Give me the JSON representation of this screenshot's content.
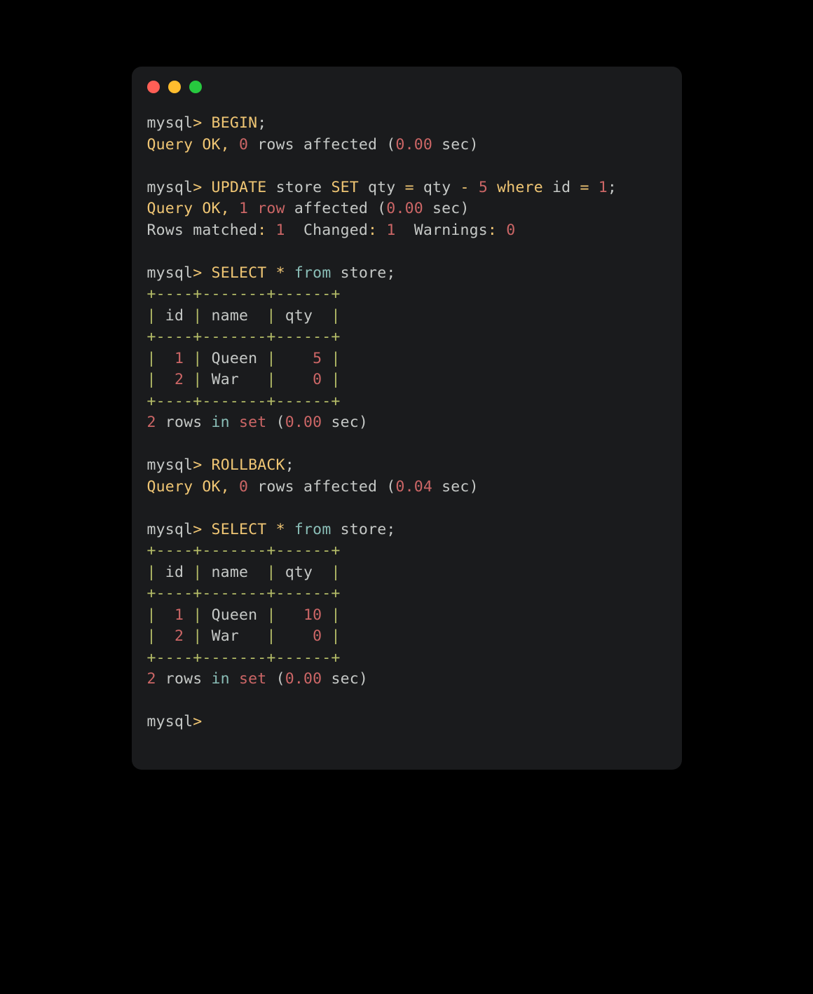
{
  "colors": {
    "traffic_red": "#ff5f56",
    "traffic_yellow": "#ffbd2e",
    "traffic_green": "#27c93f",
    "bg": "#1a1b1d",
    "text": "#c5c8c6",
    "yellow": "#f0c674",
    "red": "#cc6666",
    "cyan": "#8abeb7",
    "green": "#b5bd68"
  },
  "tokens": [
    {
      "t": "mysql",
      "c": "default"
    },
    {
      "t": ">",
      "c": "yellow"
    },
    {
      "t": " ",
      "c": "default"
    },
    {
      "t": "BEGIN",
      "c": "yellow"
    },
    {
      "t": ";",
      "c": "default"
    },
    {
      "t": "\n",
      "c": "default"
    },
    {
      "t": "Query OK,",
      "c": "yellow"
    },
    {
      "t": " ",
      "c": "default"
    },
    {
      "t": "0",
      "c": "red"
    },
    {
      "t": " rows affected (",
      "c": "default"
    },
    {
      "t": "0.00",
      "c": "red"
    },
    {
      "t": " sec)",
      "c": "default"
    },
    {
      "t": "\n",
      "c": "default"
    },
    {
      "t": "\n",
      "c": "default"
    },
    {
      "t": "mysql",
      "c": "default"
    },
    {
      "t": ">",
      "c": "yellow"
    },
    {
      "t": " ",
      "c": "default"
    },
    {
      "t": "UPDATE",
      "c": "yellow"
    },
    {
      "t": " store ",
      "c": "default"
    },
    {
      "t": "SET",
      "c": "yellow"
    },
    {
      "t": " qty ",
      "c": "default"
    },
    {
      "t": "=",
      "c": "yellow"
    },
    {
      "t": " qty ",
      "c": "default"
    },
    {
      "t": "-",
      "c": "yellow"
    },
    {
      "t": " ",
      "c": "default"
    },
    {
      "t": "5",
      "c": "red"
    },
    {
      "t": " ",
      "c": "default"
    },
    {
      "t": "where",
      "c": "yellow"
    },
    {
      "t": " id ",
      "c": "default"
    },
    {
      "t": "=",
      "c": "yellow"
    },
    {
      "t": " ",
      "c": "default"
    },
    {
      "t": "1",
      "c": "red"
    },
    {
      "t": ";",
      "c": "default"
    },
    {
      "t": "\n",
      "c": "default"
    },
    {
      "t": "Query OK,",
      "c": "yellow"
    },
    {
      "t": " ",
      "c": "default"
    },
    {
      "t": "1",
      "c": "red"
    },
    {
      "t": " ",
      "c": "default"
    },
    {
      "t": "row",
      "c": "red"
    },
    {
      "t": " affected (",
      "c": "default"
    },
    {
      "t": "0.00",
      "c": "red"
    },
    {
      "t": " sec)",
      "c": "default"
    },
    {
      "t": "\n",
      "c": "default"
    },
    {
      "t": "Rows matched",
      "c": "default"
    },
    {
      "t": ":",
      "c": "yellow"
    },
    {
      "t": " ",
      "c": "default"
    },
    {
      "t": "1",
      "c": "red"
    },
    {
      "t": "  Changed",
      "c": "default"
    },
    {
      "t": ":",
      "c": "yellow"
    },
    {
      "t": " ",
      "c": "default"
    },
    {
      "t": "1",
      "c": "red"
    },
    {
      "t": "  Warnings",
      "c": "default"
    },
    {
      "t": ":",
      "c": "yellow"
    },
    {
      "t": " ",
      "c": "default"
    },
    {
      "t": "0",
      "c": "red"
    },
    {
      "t": "\n",
      "c": "default"
    },
    {
      "t": "\n",
      "c": "default"
    },
    {
      "t": "mysql",
      "c": "default"
    },
    {
      "t": ">",
      "c": "yellow"
    },
    {
      "t": " ",
      "c": "default"
    },
    {
      "t": "SELECT",
      "c": "yellow"
    },
    {
      "t": " ",
      "c": "default"
    },
    {
      "t": "*",
      "c": "yellow"
    },
    {
      "t": " ",
      "c": "default"
    },
    {
      "t": "from",
      "c": "cyan"
    },
    {
      "t": " store;",
      "c": "default"
    },
    {
      "t": "\n",
      "c": "default"
    },
    {
      "t": "+----+-------+------+",
      "c": "green"
    },
    {
      "t": "\n",
      "c": "default"
    },
    {
      "t": "|",
      "c": "green"
    },
    {
      "t": " id ",
      "c": "default"
    },
    {
      "t": "|",
      "c": "green"
    },
    {
      "t": " name  ",
      "c": "default"
    },
    {
      "t": "|",
      "c": "green"
    },
    {
      "t": " qty  ",
      "c": "default"
    },
    {
      "t": "|",
      "c": "green"
    },
    {
      "t": "\n",
      "c": "default"
    },
    {
      "t": "+----+-------+------+",
      "c": "green"
    },
    {
      "t": "\n",
      "c": "default"
    },
    {
      "t": "|",
      "c": "green"
    },
    {
      "t": "  ",
      "c": "default"
    },
    {
      "t": "1",
      "c": "red"
    },
    {
      "t": " ",
      "c": "default"
    },
    {
      "t": "|",
      "c": "green"
    },
    {
      "t": " Queen ",
      "c": "default"
    },
    {
      "t": "|",
      "c": "green"
    },
    {
      "t": "    ",
      "c": "default"
    },
    {
      "t": "5",
      "c": "red"
    },
    {
      "t": " ",
      "c": "default"
    },
    {
      "t": "|",
      "c": "green"
    },
    {
      "t": "\n",
      "c": "default"
    },
    {
      "t": "|",
      "c": "green"
    },
    {
      "t": "  ",
      "c": "default"
    },
    {
      "t": "2",
      "c": "red"
    },
    {
      "t": " ",
      "c": "default"
    },
    {
      "t": "|",
      "c": "green"
    },
    {
      "t": " War   ",
      "c": "default"
    },
    {
      "t": "|",
      "c": "green"
    },
    {
      "t": "    ",
      "c": "default"
    },
    {
      "t": "0",
      "c": "red"
    },
    {
      "t": " ",
      "c": "default"
    },
    {
      "t": "|",
      "c": "green"
    },
    {
      "t": "\n",
      "c": "default"
    },
    {
      "t": "+----+-------+------+",
      "c": "green"
    },
    {
      "t": "\n",
      "c": "default"
    },
    {
      "t": "2",
      "c": "red"
    },
    {
      "t": " rows ",
      "c": "default"
    },
    {
      "t": "in",
      "c": "cyan"
    },
    {
      "t": " ",
      "c": "default"
    },
    {
      "t": "set",
      "c": "red"
    },
    {
      "t": " (",
      "c": "default"
    },
    {
      "t": "0.00",
      "c": "red"
    },
    {
      "t": " sec)",
      "c": "default"
    },
    {
      "t": "\n",
      "c": "default"
    },
    {
      "t": "\n",
      "c": "default"
    },
    {
      "t": "mysql",
      "c": "default"
    },
    {
      "t": ">",
      "c": "yellow"
    },
    {
      "t": " ",
      "c": "default"
    },
    {
      "t": "ROLLBACK",
      "c": "yellow"
    },
    {
      "t": ";",
      "c": "default"
    },
    {
      "t": "\n",
      "c": "default"
    },
    {
      "t": "Query OK,",
      "c": "yellow"
    },
    {
      "t": " ",
      "c": "default"
    },
    {
      "t": "0",
      "c": "red"
    },
    {
      "t": " rows affected (",
      "c": "default"
    },
    {
      "t": "0.04",
      "c": "red"
    },
    {
      "t": " sec)",
      "c": "default"
    },
    {
      "t": "\n",
      "c": "default"
    },
    {
      "t": "\n",
      "c": "default"
    },
    {
      "t": "mysql",
      "c": "default"
    },
    {
      "t": ">",
      "c": "yellow"
    },
    {
      "t": " ",
      "c": "default"
    },
    {
      "t": "SELECT",
      "c": "yellow"
    },
    {
      "t": " ",
      "c": "default"
    },
    {
      "t": "*",
      "c": "yellow"
    },
    {
      "t": " ",
      "c": "default"
    },
    {
      "t": "from",
      "c": "cyan"
    },
    {
      "t": " store;",
      "c": "default"
    },
    {
      "t": "\n",
      "c": "default"
    },
    {
      "t": "+----+-------+------+",
      "c": "green"
    },
    {
      "t": "\n",
      "c": "default"
    },
    {
      "t": "|",
      "c": "green"
    },
    {
      "t": " id ",
      "c": "default"
    },
    {
      "t": "|",
      "c": "green"
    },
    {
      "t": " name  ",
      "c": "default"
    },
    {
      "t": "|",
      "c": "green"
    },
    {
      "t": " qty  ",
      "c": "default"
    },
    {
      "t": "|",
      "c": "green"
    },
    {
      "t": "\n",
      "c": "default"
    },
    {
      "t": "+----+-------+------+",
      "c": "green"
    },
    {
      "t": "\n",
      "c": "default"
    },
    {
      "t": "|",
      "c": "green"
    },
    {
      "t": "  ",
      "c": "default"
    },
    {
      "t": "1",
      "c": "red"
    },
    {
      "t": " ",
      "c": "default"
    },
    {
      "t": "|",
      "c": "green"
    },
    {
      "t": " Queen ",
      "c": "default"
    },
    {
      "t": "|",
      "c": "green"
    },
    {
      "t": "   ",
      "c": "default"
    },
    {
      "t": "10",
      "c": "red"
    },
    {
      "t": " ",
      "c": "default"
    },
    {
      "t": "|",
      "c": "green"
    },
    {
      "t": "\n",
      "c": "default"
    },
    {
      "t": "|",
      "c": "green"
    },
    {
      "t": "  ",
      "c": "default"
    },
    {
      "t": "2",
      "c": "red"
    },
    {
      "t": " ",
      "c": "default"
    },
    {
      "t": "|",
      "c": "green"
    },
    {
      "t": " War   ",
      "c": "default"
    },
    {
      "t": "|",
      "c": "green"
    },
    {
      "t": "    ",
      "c": "default"
    },
    {
      "t": "0",
      "c": "red"
    },
    {
      "t": " ",
      "c": "default"
    },
    {
      "t": "|",
      "c": "green"
    },
    {
      "t": "\n",
      "c": "default"
    },
    {
      "t": "+----+-------+------+",
      "c": "green"
    },
    {
      "t": "\n",
      "c": "default"
    },
    {
      "t": "2",
      "c": "red"
    },
    {
      "t": " rows ",
      "c": "default"
    },
    {
      "t": "in",
      "c": "cyan"
    },
    {
      "t": " ",
      "c": "default"
    },
    {
      "t": "set",
      "c": "red"
    },
    {
      "t": " (",
      "c": "default"
    },
    {
      "t": "0.00",
      "c": "red"
    },
    {
      "t": " sec)",
      "c": "default"
    },
    {
      "t": "\n",
      "c": "default"
    },
    {
      "t": "\n",
      "c": "default"
    },
    {
      "t": "mysql",
      "c": "default"
    },
    {
      "t": ">",
      "c": "yellow"
    }
  ]
}
